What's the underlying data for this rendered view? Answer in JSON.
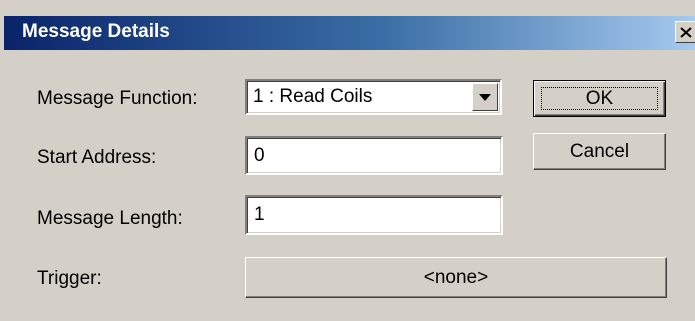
{
  "window": {
    "title": "Message Details",
    "close_glyph": "✕"
  },
  "form": {
    "message_function": {
      "label": "Message Function:",
      "selected": "1 : Read Coils"
    },
    "start_address": {
      "label": "Start Address:",
      "value": "0"
    },
    "message_length": {
      "label": "Message Length:",
      "value": "1"
    },
    "trigger": {
      "label": "Trigger:",
      "value": "<none>"
    }
  },
  "buttons": {
    "ok_label": "OK",
    "cancel_label": "Cancel"
  },
  "colors": {
    "title_gradient_start": "#0a246a",
    "title_gradient_end": "#a6caf0",
    "dialog_face": "#d4d0c8"
  }
}
